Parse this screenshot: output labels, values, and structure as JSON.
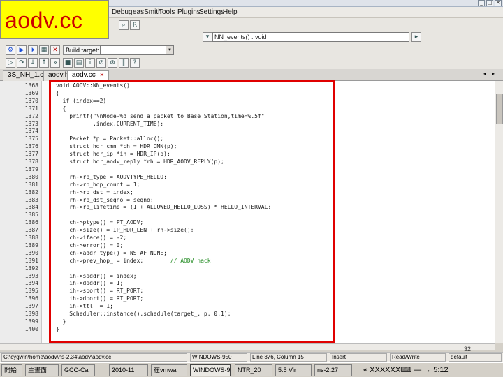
{
  "slide": {
    "title": "aodv.cc",
    "page_number": "32"
  },
  "window": {
    "controls": [
      "_",
      "□",
      "✕"
    ]
  },
  "menu": [
    {
      "label": "Debug"
    },
    {
      "label": "easSmith"
    },
    {
      "label": "Tools"
    },
    {
      "label": "Plugins"
    },
    {
      "label": "Settings"
    },
    {
      "label": "Help"
    }
  ],
  "toolbar": {
    "function_combo": "NN_events() : void",
    "build_label": "Build target:"
  },
  "tabs": [
    {
      "label": "3S_NH_1.cc",
      "active": false
    },
    {
      "label": "aodv.h",
      "active": false
    },
    {
      "label": "aodv.cc",
      "active": true,
      "close": "✕"
    }
  ],
  "editor": {
    "lines": [
      {
        "no": "1368",
        "text": "void AODV::NN_events()"
      },
      {
        "no": "1369",
        "text": "{"
      },
      {
        "no": "1370",
        "text": "  if (index==2)"
      },
      {
        "no": "1371",
        "text": "  {"
      },
      {
        "no": "1372",
        "text": "    printf(\"\\nNode-%d send a packet to Base Station,time=%.5f\""
      },
      {
        "no": "1373",
        "text": "           ,index,CURRENT_TIME);"
      },
      {
        "no": "1374",
        "text": ""
      },
      {
        "no": "1375",
        "text": "    Packet *p = Packet::alloc();"
      },
      {
        "no": "1376",
        "text": "    struct hdr_cmn *ch = HDR_CMN(p);"
      },
      {
        "no": "1377",
        "text": "    struct hdr_ip *ih = HDR_IP(p);"
      },
      {
        "no": "1378",
        "text": "    struct hdr_aodv_reply *rh = HDR_AODV_REPLY(p);"
      },
      {
        "no": "1379",
        "text": ""
      },
      {
        "no": "1380",
        "text": "    rh->rp_type = AODVTYPE_HELLO;"
      },
      {
        "no": "1381",
        "text": "    rh->rp_hop_count = 1;"
      },
      {
        "no": "1382",
        "text": "    rh->rp_dst = index;"
      },
      {
        "no": "1383",
        "text": "    rh->rp_dst_seqno = seqno;"
      },
      {
        "no": "1384",
        "text": "    rh->rp_lifetime = (1 + ALLOWED_HELLO_LOSS) * HELLO_INTERVAL;"
      },
      {
        "no": "1385",
        "text": ""
      },
      {
        "no": "1386",
        "text": "    ch->ptype() = PT_AODV;"
      },
      {
        "no": "1387",
        "text": "    ch->size() = IP_HDR_LEN + rh->size();"
      },
      {
        "no": "1388",
        "text": "    ch->iface() = -2;"
      },
      {
        "no": "1389",
        "text": "    ch->error() = 0;"
      },
      {
        "no": "1390",
        "text": "    ch->addr_type() = NS_AF_NONE;"
      },
      {
        "no": "1391",
        "text": "    ch->prev_hop_ = index;",
        "comment": "// AODV hack"
      },
      {
        "no": "1392",
        "text": ""
      },
      {
        "no": "1393",
        "text": "    ih->saddr() = index;"
      },
      {
        "no": "1394",
        "text": "    ih->daddr() = 1;"
      },
      {
        "no": "1395",
        "text": "    ih->sport() = RT_PORT;"
      },
      {
        "no": "1396",
        "text": "    ih->dport() = RT_PORT;"
      },
      {
        "no": "1397",
        "text": "    ih->ttl_ = 1;"
      },
      {
        "no": "1398",
        "text": "    Scheduler::instance().schedule(target_, p, 0.1);"
      },
      {
        "no": "1399",
        "text": "  }"
      },
      {
        "no": "1400",
        "text": "}"
      }
    ]
  },
  "status": {
    "path": "C:\\cygwin\\home\\aodv\\ns-2.34\\aodv\\aodv.cc",
    "encoding": "WINDOWS-950",
    "position": "Line 376, Column 15",
    "insert": "Insert",
    "mode": "Read/Write",
    "profile": "default"
  },
  "taskbar": {
    "start": "開始",
    "tasks": [
      {
        "label": "主畫面"
      },
      {
        "label": "GCC-Ca"
      },
      {
        "label": "2010-11"
      },
      {
        "label": "在vmwa"
      },
      {
        "label": "WINDOWS-950",
        "active": true
      },
      {
        "label": "NTR_20"
      },
      {
        "label": "5.5 Vir"
      },
      {
        "label": "ns-2.27"
      }
    ],
    "tray": "« XXXXXX⌨ — → 5:12"
  }
}
